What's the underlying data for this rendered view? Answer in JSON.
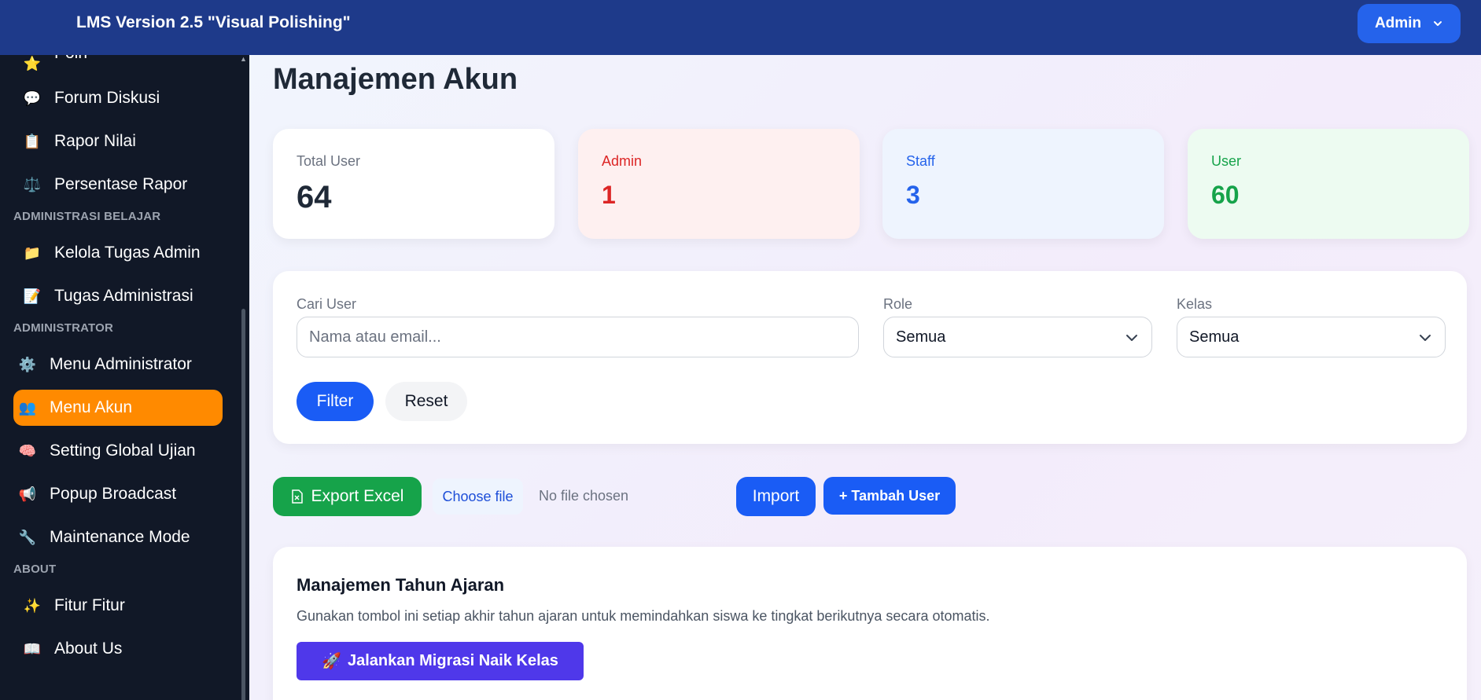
{
  "header": {
    "app_title": "LMS Version 2.5 \"Visual Polishing\"",
    "user_menu_label": "Admin"
  },
  "sidebar": {
    "items_top": [
      {
        "label": "Poin",
        "icon": "⭐"
      },
      {
        "label": "Forum Diskusi",
        "icon": "💬"
      },
      {
        "label": "Rapor Nilai",
        "icon": "📋"
      },
      {
        "label": "Persentase Rapor",
        "icon": "⚖️"
      }
    ],
    "section_admin_belajar": "ADMINISTRASI BELAJAR",
    "items_admin_belajar": [
      {
        "label": "Kelola Tugas Admin",
        "icon": "📁"
      },
      {
        "label": "Tugas Administrasi",
        "icon": "📝"
      }
    ],
    "section_administrator": "ADMINISTRATOR",
    "items_administrator": [
      {
        "label": "Menu Administrator",
        "icon": "⚙️"
      },
      {
        "label": "Menu Akun",
        "icon": "👥",
        "active": true
      },
      {
        "label": "Setting Global Ujian",
        "icon": "🧠"
      },
      {
        "label": "Popup Broadcast",
        "icon": "📢"
      },
      {
        "label": "Maintenance Mode",
        "icon": "🔧"
      }
    ],
    "section_about": "ABOUT",
    "items_about": [
      {
        "label": "Fitur Fitur",
        "icon": "✨"
      },
      {
        "label": "About Us",
        "icon": "📖"
      }
    ],
    "active_color": "#ff8a00"
  },
  "main": {
    "page_title": "Manajemen Akun",
    "stats": {
      "total": {
        "label": "Total User",
        "value": "64"
      },
      "admin": {
        "label": "Admin",
        "value": "1"
      },
      "staff": {
        "label": "Staff",
        "value": "3"
      },
      "user": {
        "label": "User",
        "value": "60"
      }
    },
    "filter": {
      "search_label": "Cari User",
      "search_placeholder": "Nama atau email...",
      "role_label": "Role",
      "role_value": "Semua",
      "kelas_label": "Kelas",
      "kelas_value": "Semua",
      "filter_button": "Filter",
      "reset_button": "Reset"
    },
    "actions": {
      "export_button": "Export Excel",
      "choose_file_button": "Choose file",
      "no_file_text": "No file chosen",
      "import_button": "Import",
      "add_user_button": "+ Tambah User"
    },
    "academic_year": {
      "title": "Manajemen Tahun Ajaran",
      "description": "Gunakan tombol ini setiap akhir tahun ajaran untuk memindahkan siswa ke tingkat berikutnya secara otomatis.",
      "migrate_button": "Jalankan Migrasi Naik Kelas",
      "migrate_icon": "🚀"
    }
  },
  "colors": {
    "topbar": "#1e3a8a",
    "primary": "#1a5cf5",
    "export": "#16a34a",
    "migrate": "#4f38ea"
  }
}
